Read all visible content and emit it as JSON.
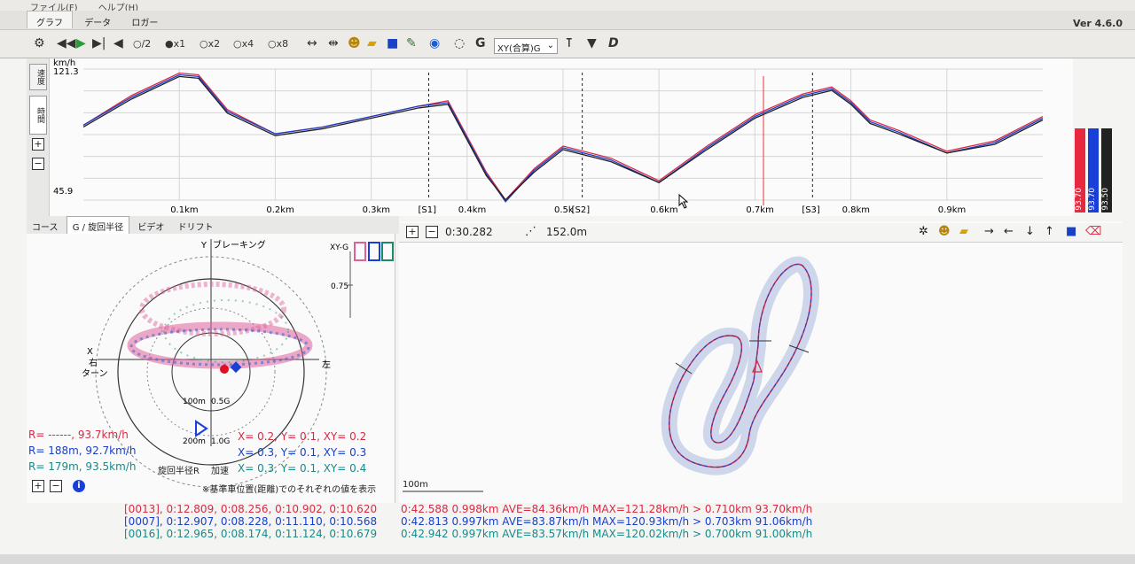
{
  "menu": {
    "file": "ファイル(F)",
    "help": "ヘルプ(H)"
  },
  "submenu": {
    "graph": "グラフ",
    "data": "データ",
    "logger": "ロガー"
  },
  "toolbar": {
    "speed_options": [
      "○/2",
      "●x1",
      "○x2",
      "○x4",
      "○x8"
    ],
    "g_label": "G",
    "mode_select": "XY(合算)G",
    "d_label": "D"
  },
  "version": "Ver 4.6.0",
  "graph": {
    "unit": "km/h",
    "y_max_label": "121.3",
    "y_min_label": "45.9",
    "side_tabs": {
      "speed": "速度",
      "time": "時間"
    },
    "x_ticks": [
      "0.1km",
      "0.2km",
      "0.3km",
      "0.4km",
      "0.5k",
      "0.6km",
      "0.7km",
      "0.8km",
      "0.9km"
    ],
    "sectors": [
      "[S1]",
      "[S2]",
      "[S3]"
    ]
  },
  "chart_data": {
    "type": "line",
    "xlabel": "",
    "ylabel": "km/h",
    "ylim": [
      45.9,
      121.3
    ],
    "xlim": [
      0.0,
      1.0
    ],
    "x": [
      0.0,
      0.05,
      0.1,
      0.12,
      0.15,
      0.2,
      0.25,
      0.3,
      0.35,
      0.38,
      0.42,
      0.44,
      0.47,
      0.5,
      0.55,
      0.6,
      0.65,
      0.7,
      0.75,
      0.78,
      0.8,
      0.82,
      0.85,
      0.9,
      0.95,
      1.0
    ],
    "series": [
      {
        "color": "#d82a45",
        "values": [
          89,
          106,
          119,
          118,
          98,
          84,
          88,
          94,
          100,
          103,
          62,
          46,
          64,
          77,
          70,
          57,
          77,
          95,
          107,
          111,
          103,
          92,
          86,
          74,
          80,
          94
        ]
      },
      {
        "color": "#1a3fc8",
        "values": [
          89,
          105,
          118,
          117,
          97,
          84,
          88,
          94,
          100,
          102,
          61,
          45,
          63,
          76,
          69,
          56,
          76,
          94,
          106,
          110,
          102,
          91,
          85,
          73,
          79,
          93
        ]
      },
      {
        "color": "#222222",
        "values": [
          88,
          104,
          117,
          116,
          96,
          83,
          87,
          93,
          99,
          101,
          60,
          46,
          62,
          75,
          68,
          56,
          75,
          93,
          105,
          109,
          101,
          90,
          84,
          73,
          78,
          92
        ]
      }
    ]
  },
  "bars": [
    {
      "label": "93.70",
      "color": "#e8283f"
    },
    {
      "label": "93.70",
      "color": "#1a3fd8"
    },
    {
      "label": "93.50",
      "color": "#222222"
    }
  ],
  "lower_tabs": [
    "コース",
    "G / 旋回半径",
    "ビデオ",
    "ドリフト"
  ],
  "gg": {
    "y_label": "Y",
    "braking": "ブレーキング",
    "x_label": "X",
    "right_turn_1": "右",
    "right_turn_2": "ターン",
    "left": "左",
    "xyg": "XY-G",
    "scale_075": "0.75",
    "r100": "100m",
    "g05": "0.5G",
    "r200": "200m",
    "g10": "1.0G",
    "turn_radius": "旋回半径R",
    "accel": "加速"
  },
  "gg_rows": [
    {
      "r": "R= ------,  93.7km/h",
      "xy": "X=  0.2, Y=  0.1, XY= 0.2"
    },
    {
      "r": "R= 188m,  92.7km/h",
      "xy": "X=  0.3, Y=  0.1, XY= 0.3"
    },
    {
      "r": "R= 179m,  93.5km/h",
      "xy": "X=  0.3, Y=  0.1, XY= 0.4"
    }
  ],
  "gg_note": "※基準車位置(距離)でのそれぞれの値を表示",
  "map": {
    "time": "0:30.282",
    "distance": "152.0m",
    "scale": "100m"
  },
  "lap_table": [
    "[0013], 0:12.809, 0:08.256, 0:10.902, 0:10.620",
    "[0007], 0:12.907, 0:08.228, 0:11.110, 0:10.568",
    "[0016], 0:12.965, 0:08.174, 0:11.124, 0:10.679"
  ],
  "lap_summary": [
    "0:42.588 0.998km AVE=84.36km/h MAX=121.28km/h > 0.710km 93.70km/h",
    "0:42.813 0.997km AVE=83.87km/h MAX=120.93km/h > 0.703km 91.06km/h",
    "0:42.942 0.997km AVE=83.57km/h MAX=120.02km/h > 0.700km 91.00km/h"
  ]
}
